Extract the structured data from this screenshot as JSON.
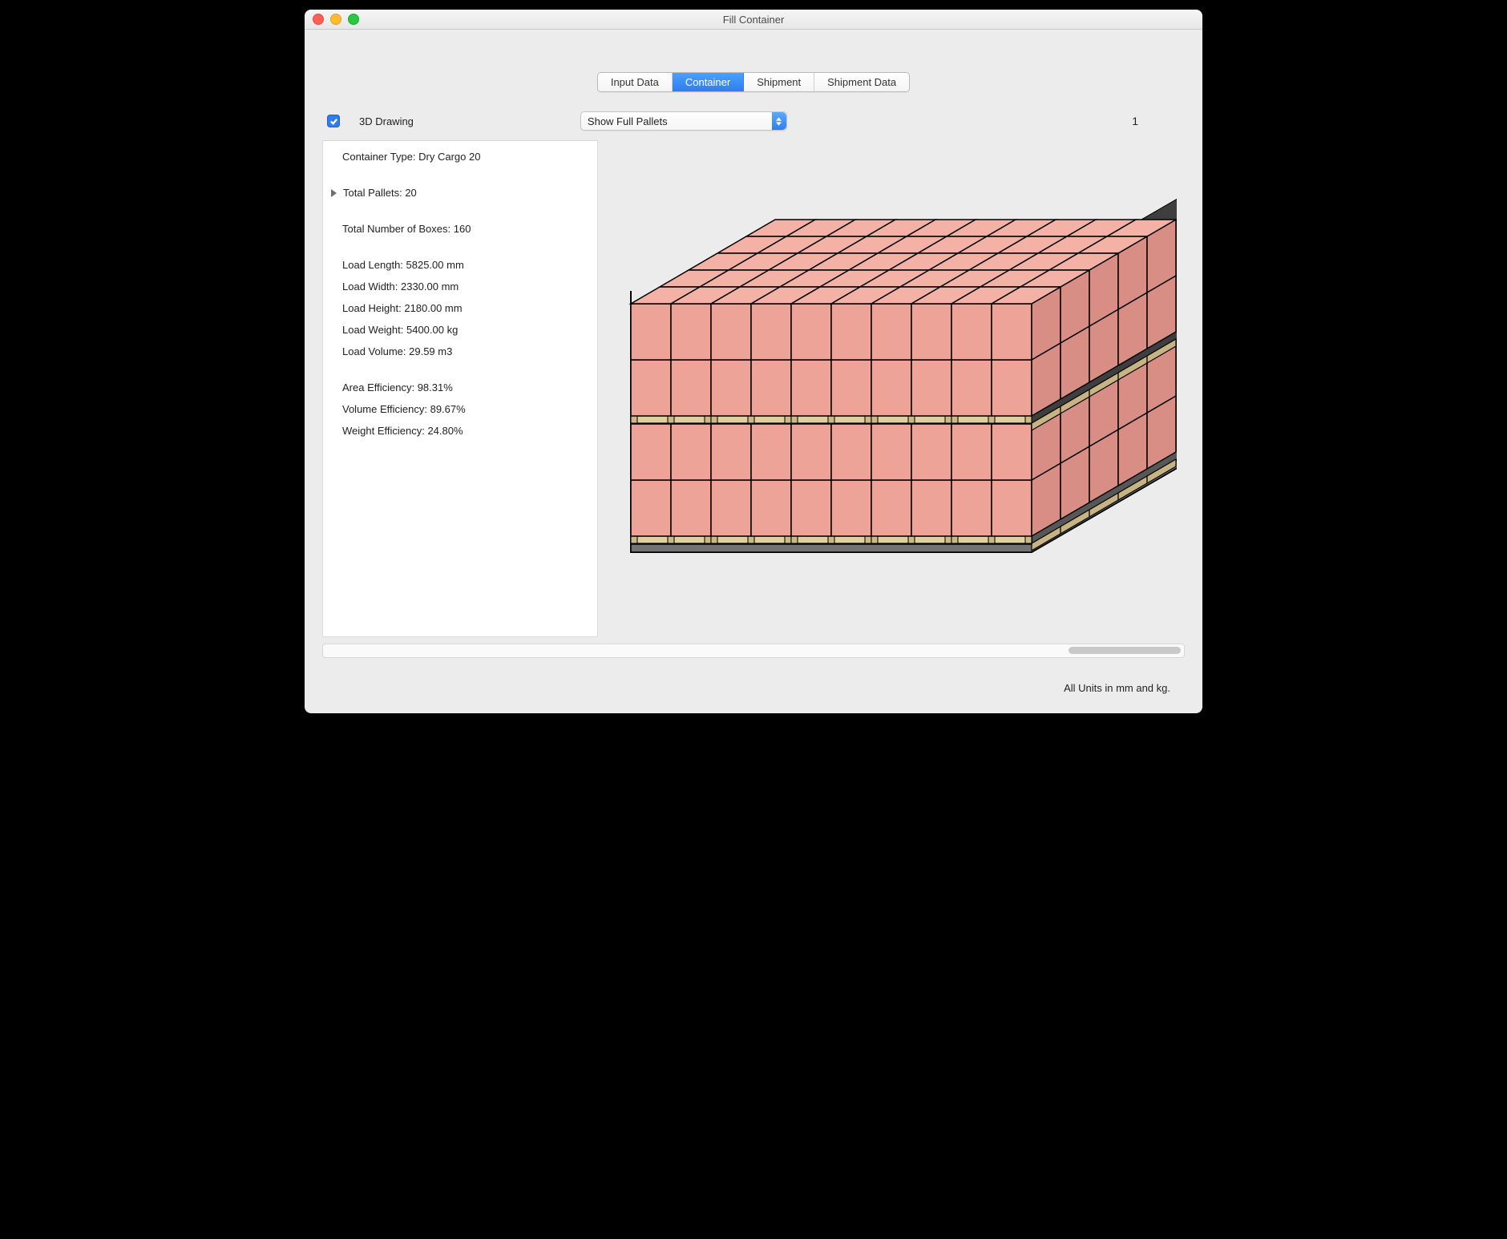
{
  "window": {
    "title": "Fill Container"
  },
  "tabs": {
    "input": "Input Data",
    "container": "Container",
    "shipment": "Shipment",
    "shipment_data": "Shipment Data",
    "active": "container"
  },
  "toolbar": {
    "drawing_label": "3D Drawing",
    "drawing_checked": true,
    "popup_value": "Show Full Pallets",
    "page_count": "1"
  },
  "info": {
    "container_type_line": "Container Type: Dry Cargo 20",
    "total_pallets_line": "Total Pallets: 20",
    "total_boxes_line": "Total Number of Boxes: 160",
    "load_length_line": "Load Length: 5825.00 mm",
    "load_width_line": "Load Width: 2330.00 mm",
    "load_height_line": "Load Height: 2180.00 mm",
    "load_weight_line": "Load Weight: 5400.00 kg",
    "load_volume_line": "Load Volume: 29.59 m3",
    "area_eff_line": "Area Efficiency: 98.31%",
    "volume_eff_line": "Volume Efficiency: 89.67%",
    "weight_eff_line": "Weight Efficiency: 24.80%"
  },
  "footer": {
    "units": "All Units in mm and kg."
  }
}
